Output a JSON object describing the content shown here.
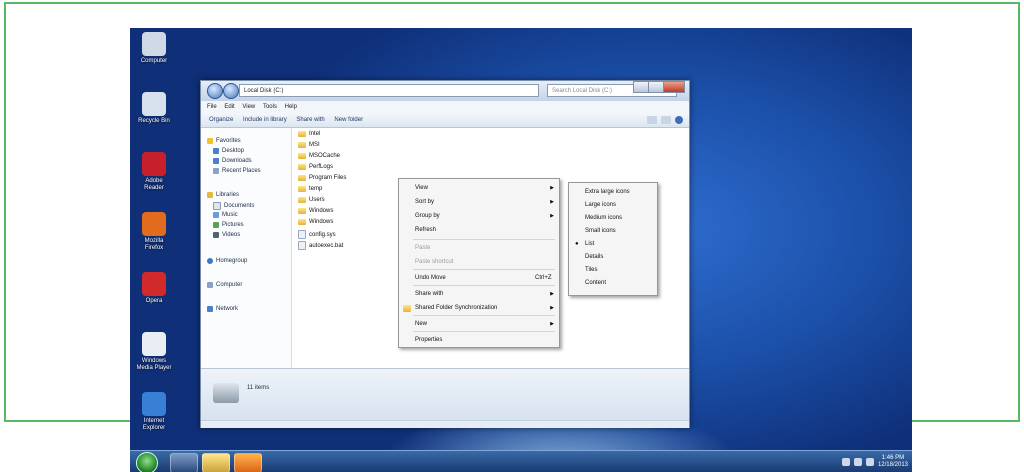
{
  "explorer": {
    "address": "Local Disk (C:)",
    "search_placeholder": "Search Local Disk (C:)",
    "menu": [
      "File",
      "Edit",
      "View",
      "Tools",
      "Help"
    ],
    "toolbar": [
      "Organize",
      "Include in library",
      "Share with",
      "New folder"
    ],
    "nav": {
      "favorites": "Favorites",
      "favorites_items": [
        "Desktop",
        "Downloads",
        "Recent Places"
      ],
      "libraries": "Libraries",
      "libraries_items": [
        "Documents",
        "Music",
        "Pictures",
        "Videos"
      ],
      "homegroup": "Homegroup",
      "computer": "Computer",
      "network": "Network"
    },
    "files": [
      {
        "name": "Intel",
        "type": "folder"
      },
      {
        "name": "MSI",
        "type": "folder"
      },
      {
        "name": "MSOCache",
        "type": "folder"
      },
      {
        "name": "PerfLogs",
        "type": "folder"
      },
      {
        "name": "Program Files",
        "type": "folder"
      },
      {
        "name": "temp",
        "type": "folder"
      },
      {
        "name": "Users",
        "type": "folder"
      },
      {
        "name": "Windows",
        "type": "folder"
      },
      {
        "name": "Windows",
        "type": "folder"
      },
      {
        "name": "config.sys",
        "type": "file"
      },
      {
        "name": "autoexec.bat",
        "type": "file"
      }
    ],
    "details_text": "11 items"
  },
  "context_menu": {
    "items": [
      {
        "label": "View",
        "arrow": true,
        "disabled": false
      },
      {
        "label": "Sort by",
        "arrow": true,
        "disabled": false
      },
      {
        "label": "Group by",
        "arrow": true,
        "disabled": false
      },
      {
        "label": "Refresh",
        "arrow": false,
        "disabled": false
      },
      {
        "label": "Paste",
        "arrow": false,
        "disabled": true
      },
      {
        "label": "Paste shortcut",
        "arrow": false,
        "disabled": true
      },
      {
        "label": "Undo Move",
        "arrow": false,
        "disabled": false,
        "shortcut": "Ctrl+Z"
      },
      {
        "label": "Share with",
        "arrow": true,
        "disabled": false
      },
      {
        "label": "Shared Folder Synchronization",
        "arrow": true,
        "disabled": false
      },
      {
        "label": "New",
        "arrow": true,
        "disabled": false
      },
      {
        "label": "Properties",
        "arrow": false,
        "disabled": false
      }
    ]
  },
  "submenu": {
    "items": [
      {
        "label": "Extra large icons",
        "selected": false
      },
      {
        "label": "Large icons",
        "selected": false
      },
      {
        "label": "Medium icons",
        "selected": false
      },
      {
        "label": "Small icons",
        "selected": false
      },
      {
        "label": "List",
        "selected": true
      },
      {
        "label": "Details",
        "selected": false
      },
      {
        "label": "Tiles",
        "selected": false
      },
      {
        "label": "Content",
        "selected": false
      }
    ]
  },
  "desktop": {
    "icons": [
      {
        "label": "Computer",
        "color": "#cfd9e6"
      },
      {
        "label": "Recycle Bin",
        "color": "#d8e2ee"
      },
      {
        "label": "Adobe Reader",
        "color": "#c8202a"
      },
      {
        "label": "Mozilla Firefox",
        "color": "#e36b1d"
      },
      {
        "label": "Opera",
        "color": "#d22a2a"
      },
      {
        "label": "Windows Media Player",
        "color": "#e9eef5"
      },
      {
        "label": "Internet Explorer",
        "color": "#3a7fd6"
      }
    ]
  },
  "taskbar": {
    "clock_time": "1:46 PM",
    "clock_date": "12/18/2013"
  }
}
